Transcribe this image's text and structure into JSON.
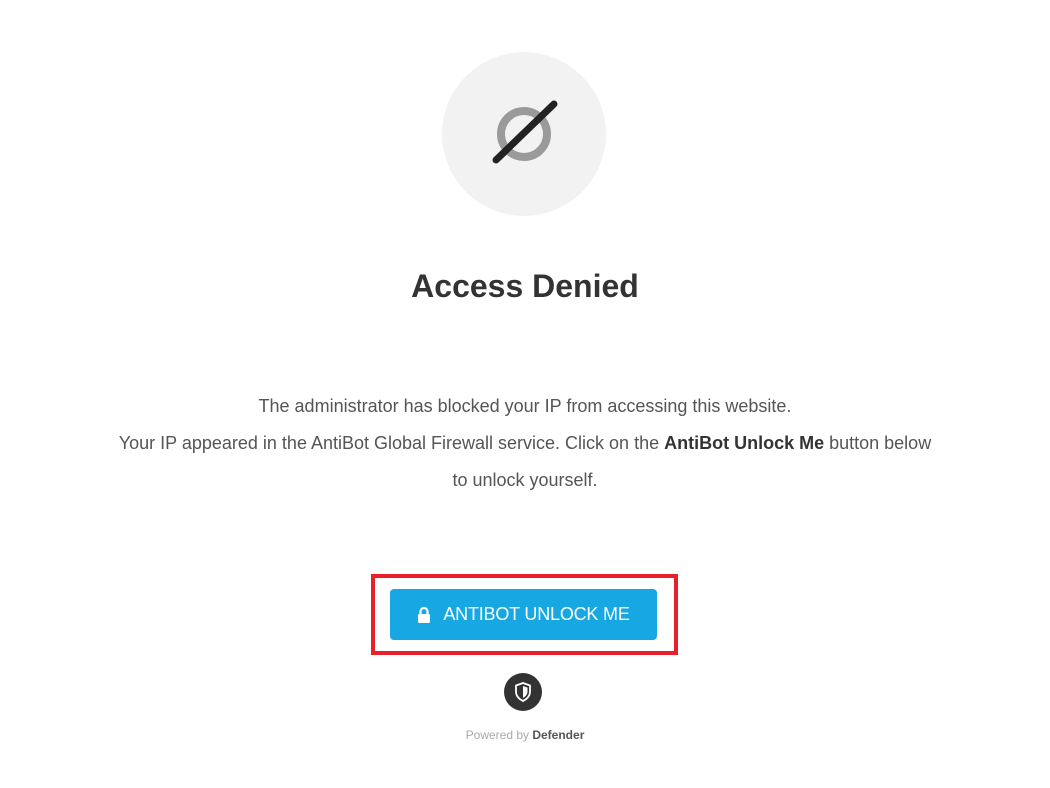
{
  "icon": {
    "name": "blocked-icon"
  },
  "heading": {
    "title": "Access Denied"
  },
  "message": {
    "line1": "The administrator has blocked your IP from accessing this website.",
    "line2_prefix": "Your IP appeared in the AntiBot Global Firewall service. Click on the ",
    "line2_bold": "AntiBot Unlock Me",
    "line2_suffix": " button below",
    "line3": "to unlock yourself."
  },
  "unlock_button": {
    "label": "ANTIBOT UNLOCK ME",
    "icon": "lock-icon",
    "color": "#17a8e3"
  },
  "highlight": {
    "color": "#e8202a"
  },
  "footer": {
    "logo_icon": "shield-icon",
    "powered_prefix": "Powered by ",
    "powered_brand": "Defender"
  }
}
